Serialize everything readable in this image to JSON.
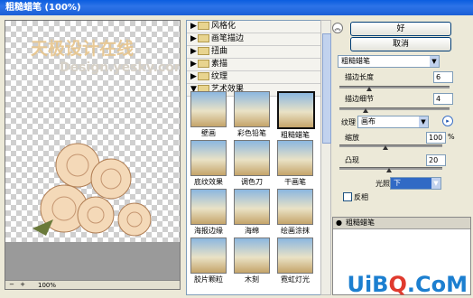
{
  "window": {
    "title": "粗糙蜡笔 (100%)"
  },
  "preview": {
    "watermark_cn": "天极设计在线",
    "watermark_en": "Design.yesky.com",
    "zoom_minus": "−",
    "zoom_plus": "+",
    "zoom": "100%"
  },
  "categories": [
    "风格化",
    "画笔描边",
    "扭曲",
    "素描",
    "纹理",
    "艺术效果"
  ],
  "filters": [
    "壁画",
    "彩色铅笔",
    "粗糙蜡笔",
    "底纹效果",
    "调色刀",
    "干画笔",
    "海报边缘",
    "海绵",
    "绘画涂抹",
    "胶片颗粒",
    "木刻",
    "霓虹灯光"
  ],
  "selected_filter": "粗糙蜡笔",
  "buttons": {
    "ok": "好",
    "cancel": "取消"
  },
  "settings": {
    "filter_select": "粗糙蜡笔",
    "stroke_length_label": "描边长度",
    "stroke_length": "6",
    "stroke_detail_label": "描边细节",
    "stroke_detail": "4",
    "texture_label": "纹理",
    "texture": "画布",
    "scaling_label": "缩放",
    "scaling": "100",
    "scaling_unit": "%",
    "relief_label": "凸现",
    "relief": "20",
    "light_label": "光照",
    "light": "下",
    "invert_label": "反相"
  },
  "layers": {
    "row_label": "粗糙蜡笔"
  },
  "logo": {
    "text_a": "UiB",
    "text_o": "Q",
    "text_b": ".CoM"
  }
}
